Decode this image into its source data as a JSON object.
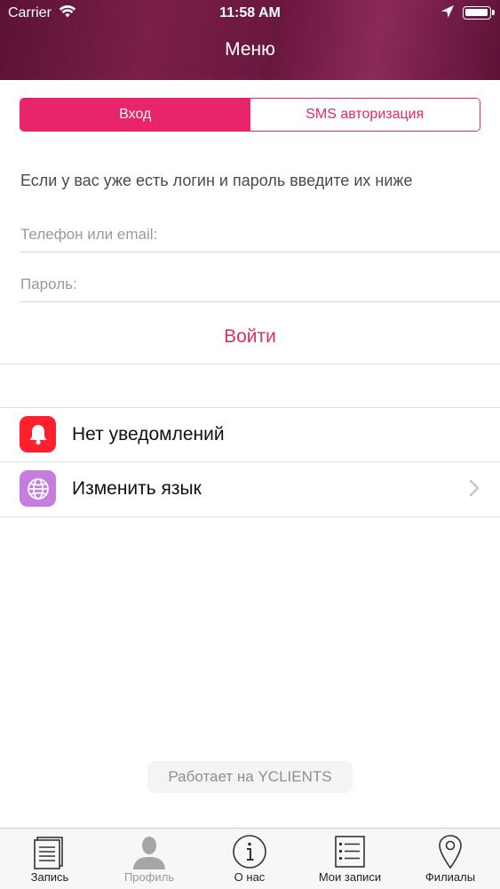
{
  "status_bar": {
    "carrier": "Carrier",
    "time": "11:58 AM",
    "icons": [
      "wifi-icon",
      "location-arrow-icon",
      "battery-icon"
    ]
  },
  "header": {
    "title": "Меню"
  },
  "login_tabs": [
    {
      "label": "Вход",
      "selected": true
    },
    {
      "label": "SMS авторизация",
      "selected": false
    }
  ],
  "form": {
    "hint": "Если у вас уже есть логин и пароль введите их ниже",
    "phone_placeholder": "Телефон или email:",
    "password_placeholder": "Пароль:",
    "submit_label": "Войти"
  },
  "menu": [
    {
      "label": "Нет уведомлений",
      "icon": "bell-icon",
      "icon_color": "#ff1f2d"
    },
    {
      "label": "Изменить язык",
      "icon": "globe-icon",
      "icon_color": "#c57ee0"
    }
  ],
  "footer": {
    "powered_by": "Работает на YCLIENTS"
  },
  "tabbar": [
    {
      "label": "Запись",
      "icon": "document-icon",
      "active": false
    },
    {
      "label": "Профиль",
      "icon": "person-icon",
      "active": true
    },
    {
      "label": "О нас",
      "icon": "info-icon",
      "active": false
    },
    {
      "label": "Мои записи",
      "icon": "list-icon",
      "active": false
    },
    {
      "label": "Филиалы",
      "icon": "map-pin-icon",
      "active": false
    }
  ],
  "colors": {
    "accent": "#e8246b",
    "header": "#6a173e"
  }
}
